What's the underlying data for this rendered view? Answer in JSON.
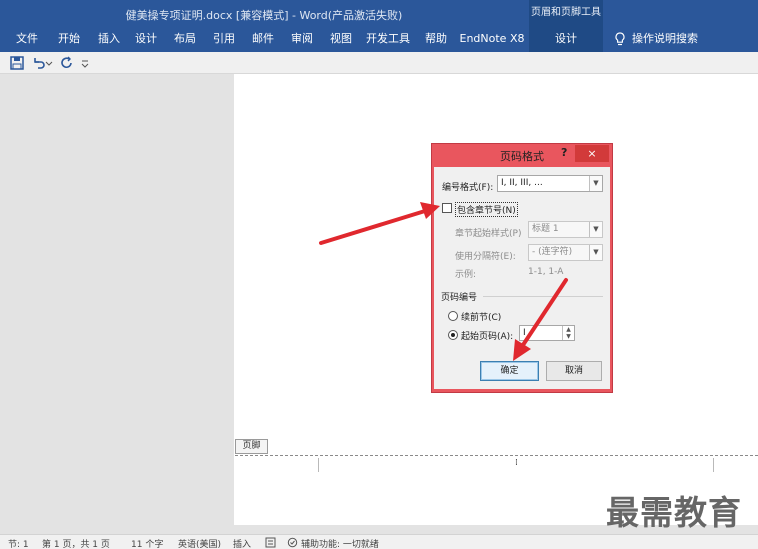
{
  "window": {
    "title": "健美操专项证明.docx [兼容模式] - Word(产品激活失败)",
    "contextual_title": "页眉和页脚工具"
  },
  "ribbon": {
    "tabs": [
      {
        "label": "文件"
      },
      {
        "label": "开始"
      },
      {
        "label": "插入"
      },
      {
        "label": "设计"
      },
      {
        "label": "布局"
      },
      {
        "label": "引用"
      },
      {
        "label": "邮件"
      },
      {
        "label": "审阅"
      },
      {
        "label": "视图"
      },
      {
        "label": "开发工具"
      },
      {
        "label": "帮助"
      },
      {
        "label": "EndNote X8"
      },
      {
        "label": "设计"
      }
    ],
    "tell_me": "操作说明搜索"
  },
  "quick_access": {
    "icons": [
      "save-icon",
      "undo-icon",
      "redo-icon",
      "customize-icon"
    ]
  },
  "document": {
    "footer_tag": "页脚"
  },
  "dialog": {
    "title": "页码格式",
    "help": "?",
    "close": "×",
    "number_format_label": "编号格式(F):",
    "number_format_value": "I, II, III, ...",
    "include_chapter_label": "包含章节号(N)",
    "chapter_style_label": "章节起始样式(P)",
    "chapter_style_value": "标题 1",
    "separator_label": "使用分隔符(E):",
    "separator_value": "-   (连字符)",
    "example_label": "示例:",
    "example_value": "1-1, 1-A",
    "page_numbering_label": "页码编号",
    "continue_label": "续前节(C)",
    "start_at_label": "起始页码(A):",
    "start_at_value": "I",
    "ok": "确定",
    "cancel": "取消"
  },
  "status_bar": {
    "section": "节: 1",
    "page": "第 1 页，共 1 页",
    "words": "11 个字",
    "language": "英语(美国)",
    "mode": "插入",
    "accessibility": "辅助功能: 一切就绪"
  },
  "watermark": "最需教育",
  "colors": {
    "ribbon_blue": "#2b579a",
    "contextual_blue": "#1f4a85",
    "dialog_frame": "#e9565e",
    "annotation_arrow": "#e0282e"
  }
}
